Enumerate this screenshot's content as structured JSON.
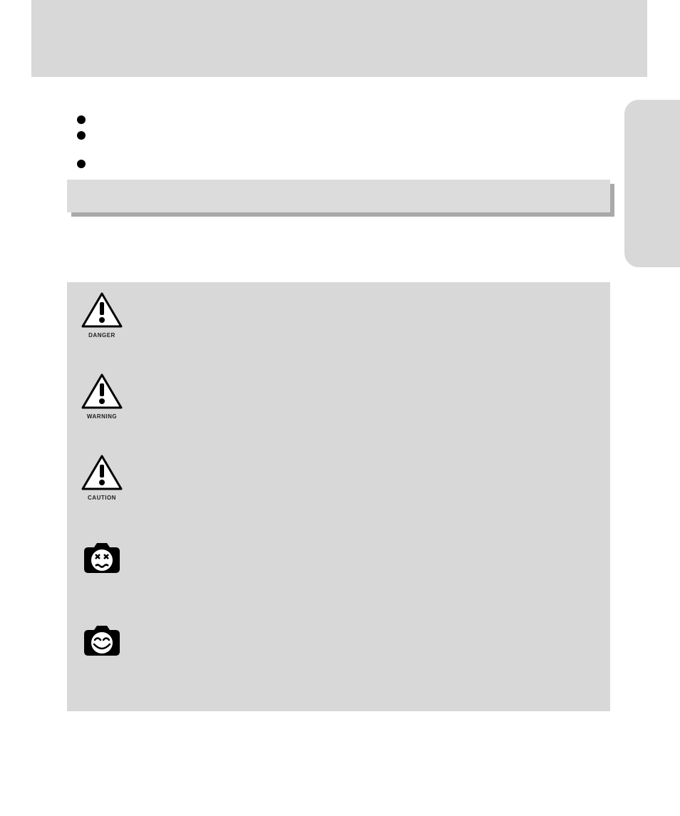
{
  "bullets": {
    "item1": "",
    "item2": "",
    "item3": ""
  },
  "callout": {
    "text": ""
  },
  "symbols": {
    "danger": {
      "label": "DANGER",
      "desc": ""
    },
    "warning": {
      "label": "WARNING",
      "desc": ""
    },
    "caution": {
      "label": "CAUTION",
      "desc": ""
    },
    "no": {
      "label": "",
      "desc": ""
    },
    "yes": {
      "label": "",
      "desc": ""
    }
  }
}
